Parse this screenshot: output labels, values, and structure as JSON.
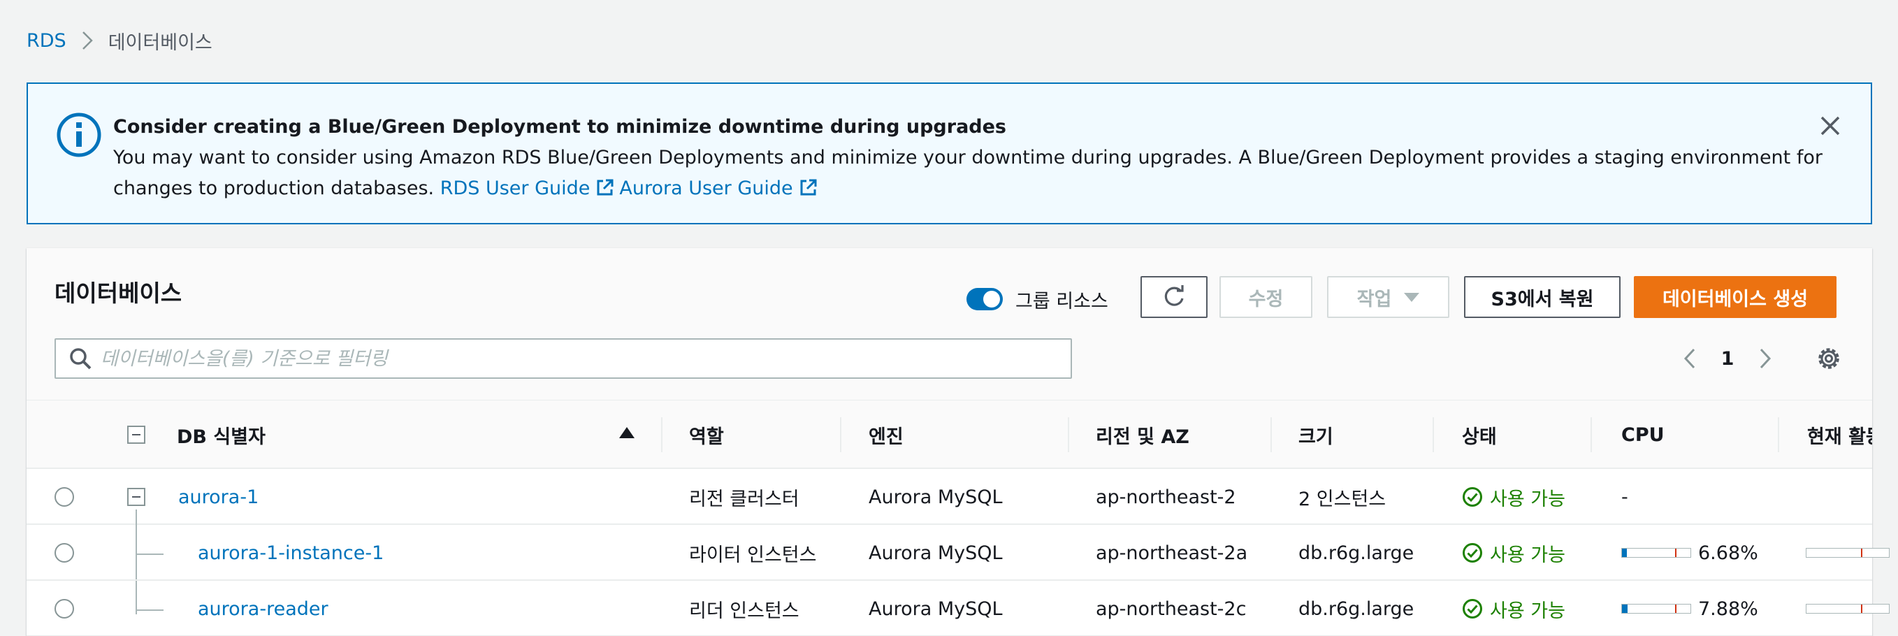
{
  "breadcrumb": {
    "root": "RDS",
    "current": "데이터베이스"
  },
  "flash": {
    "title": "Consider creating a Blue/Green Deployment to minimize downtime during upgrades",
    "body": "You may want to consider using Amazon RDS Blue/Green Deployments and minimize your downtime during upgrades. A Blue/Green Deployment provides a staging environment for changes to production databases.",
    "link1": "RDS User Guide",
    "link2": "Aurora User Guide"
  },
  "panel": {
    "title": "데이터베이스",
    "toggle_label": "그룹 리소스",
    "edit_label": "수정",
    "action_label": "작업",
    "restore_label": "S3에서 복원",
    "create_label": "데이터베이스 생성",
    "search_placeholder": "데이터베이스을(를) 기준으로 필터링",
    "page": "1"
  },
  "table": {
    "headers": {
      "id": "DB 식별자",
      "role": "역할",
      "engine": "엔진",
      "region": "리전 및 AZ",
      "size": "크기",
      "status": "상태",
      "cpu": "CPU",
      "activity": "현재 활동"
    },
    "rows": [
      {
        "id": "aurora-1",
        "role": "리전 클러스터",
        "engine": "Aurora MySQL",
        "region": "ap-northeast-2",
        "size": "2 인스턴스",
        "status": "사용 가능",
        "cpu": "-"
      },
      {
        "id": "aurora-1-instance-1",
        "role": "라이터 인스턴스",
        "engine": "Aurora MySQL",
        "region": "ap-northeast-2a",
        "size": "db.r6g.large",
        "status": "사용 가능",
        "cpu": "6.68%",
        "cpu_value": 6.68
      },
      {
        "id": "aurora-reader",
        "role": "리더 인스턴스",
        "engine": "Aurora MySQL",
        "region": "ap-northeast-2c",
        "size": "db.r6g.large",
        "status": "사용 가능",
        "cpu": "7.88%",
        "cpu_value": 7.88
      }
    ]
  },
  "colors": {
    "link": "#0073bb",
    "primary": "#ec7211",
    "success": "#1d8102",
    "info_bg": "#f1faff"
  }
}
